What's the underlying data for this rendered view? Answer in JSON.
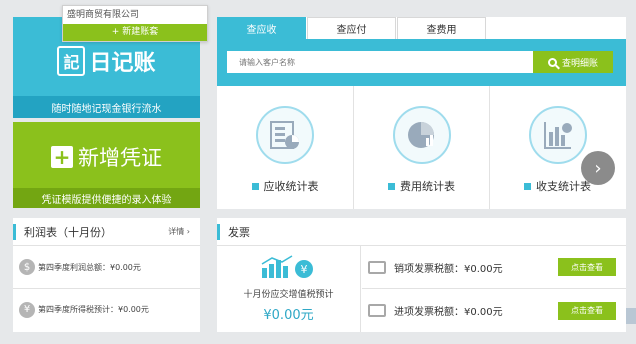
{
  "dropdown": {
    "company": "盛明商贸有限公司",
    "new_account": "+ 新建账套"
  },
  "journal": {
    "icon_char": "記",
    "title": "日记账",
    "subtitle": "随时随地记现金银行流水"
  },
  "voucher": {
    "plus": "+",
    "title": "新增凭证",
    "subtitle": "凭证模版提供便捷的录入体验"
  },
  "tabs": [
    {
      "label": "查应收",
      "active": true
    },
    {
      "label": "查应付",
      "active": false
    },
    {
      "label": "查费用",
      "active": false
    }
  ],
  "search": {
    "placeholder": "请输入客户名称",
    "button": "查明细账"
  },
  "stats": [
    {
      "label": "应收统计表",
      "icon": "receivable-report-icon"
    },
    {
      "label": "费用统计表",
      "icon": "expense-pie-icon"
    },
    {
      "label": "收支统计表",
      "icon": "income-expense-icon"
    }
  ],
  "next_arrow": "›",
  "profit": {
    "title": "利润表（十月份）",
    "more": "详情 ›",
    "rows": [
      {
        "coin": "$",
        "text": "第四季度利润总额：¥0.00元"
      },
      {
        "coin": "¥",
        "text": "第四季度所得税预计：¥0.00元"
      }
    ]
  },
  "invoice": {
    "title": "发票",
    "caption": "十月份应交增值税预计",
    "amount": "¥0.00元",
    "rows": [
      {
        "text": "销项发票税额：¥0.00元",
        "button": "点击查看"
      },
      {
        "text": "进项发票税额：¥0.00元",
        "button": "点击查看"
      }
    ]
  },
  "colors": {
    "accent_blue": "#3bbcd6",
    "accent_green": "#8bc11c"
  }
}
